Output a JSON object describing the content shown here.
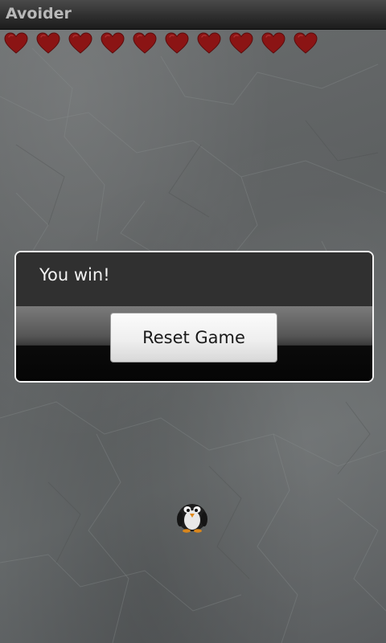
{
  "app": {
    "title": "Avoider"
  },
  "lives": {
    "count": 10,
    "icon": "heart-icon",
    "color": "#8b1414"
  },
  "dialog": {
    "message": "You win!",
    "button_label": "Reset Game"
  },
  "player": {
    "icon": "penguin-icon"
  },
  "colors": {
    "background": "#606364",
    "title_bar": "#2f2f2f",
    "dialog_border": "#f2f2f2",
    "dialog_body": "#303030"
  }
}
